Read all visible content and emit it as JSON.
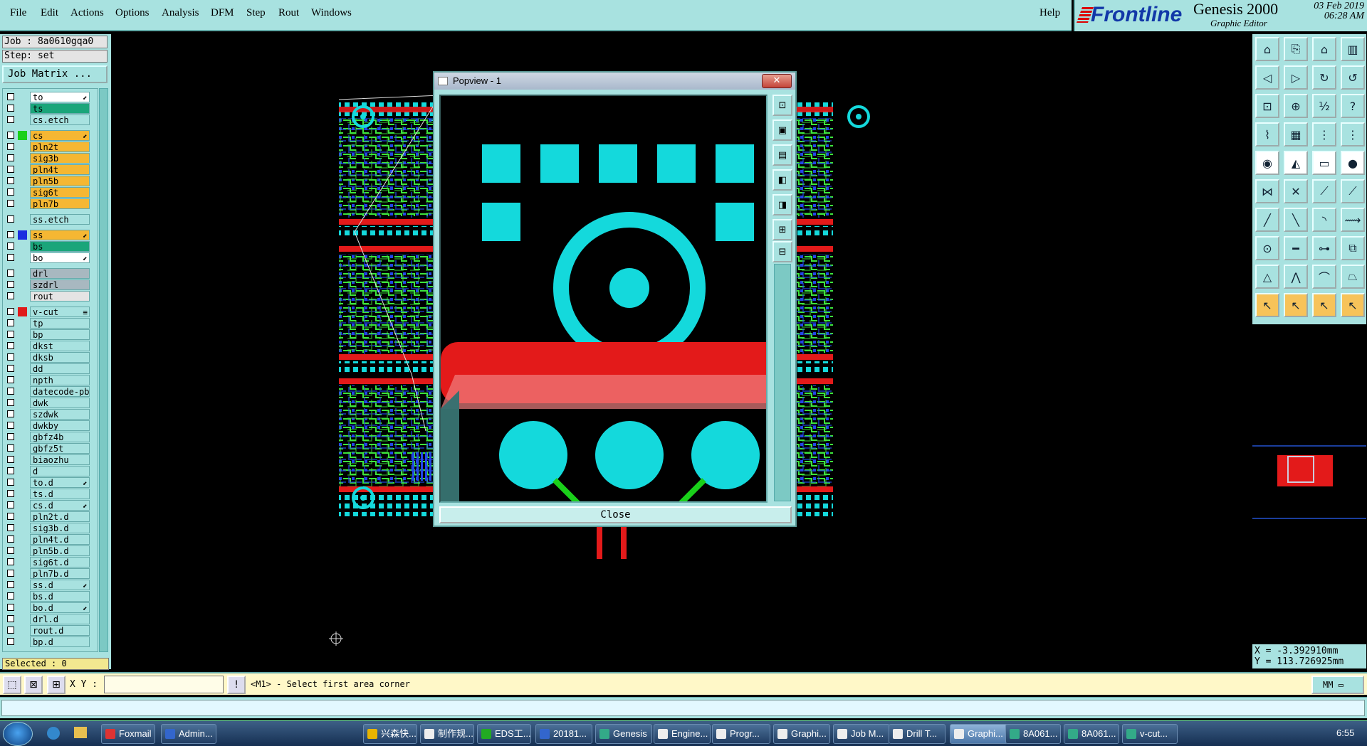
{
  "menubar": {
    "items": [
      "File",
      "Edit",
      "Actions",
      "Options",
      "Analysis",
      "DFM",
      "Step",
      "Rout",
      "Windows"
    ],
    "help": "Help"
  },
  "brand": {
    "logo": "Frontline",
    "title": "Genesis 2000",
    "subtitle": "Graphic Editor",
    "date": "03 Feb 2019",
    "time": "06:28 AM"
  },
  "job": {
    "job_label": "Job : 8a0610gqa0",
    "step_label": "Step: set",
    "matrix_button": "Job Matrix ..."
  },
  "layers": [
    {
      "name": "to",
      "bg": "#ffffff",
      "swatch": "",
      "mark": "⬋"
    },
    {
      "name": "ts",
      "bg": "#1aa57a",
      "swatch": "",
      "mark": ""
    },
    {
      "name": "cs.etch",
      "bg": "#a8e2e0",
      "swatch": "",
      "mark": ""
    },
    {
      "name": "cs",
      "bg": "#f5b733",
      "swatch": "#1ad01a",
      "mark": "⬋"
    },
    {
      "name": "pln2t",
      "bg": "#f5b733",
      "swatch": "",
      "mark": ""
    },
    {
      "name": "sig3b",
      "bg": "#f5b733",
      "swatch": "",
      "mark": ""
    },
    {
      "name": "pln4t",
      "bg": "#f5b733",
      "swatch": "",
      "mark": ""
    },
    {
      "name": "pln5b",
      "bg": "#f5b733",
      "swatch": "",
      "mark": ""
    },
    {
      "name": "sig6t",
      "bg": "#f5b733",
      "swatch": "",
      "mark": ""
    },
    {
      "name": "pln7b",
      "bg": "#f5b733",
      "swatch": "",
      "mark": ""
    },
    {
      "name": "ss.etch",
      "bg": "#a8e2e0",
      "swatch": "",
      "mark": ""
    },
    {
      "name": "ss",
      "bg": "#f5b733",
      "swatch": "#1a2ee0",
      "mark": "⬋"
    },
    {
      "name": "bs",
      "bg": "#1aa57a",
      "swatch": "",
      "mark": ""
    },
    {
      "name": "bo",
      "bg": "#ffffff",
      "swatch": "",
      "mark": "⬋"
    },
    {
      "name": "drl",
      "bg": "#a8b8c0",
      "swatch": "",
      "mark": ""
    },
    {
      "name": "szdrl",
      "bg": "#a8b8c0",
      "swatch": "",
      "mark": ""
    },
    {
      "name": "rout",
      "bg": "#e4e4e4",
      "swatch": "",
      "mark": ""
    },
    {
      "name": "v-cut",
      "bg": "#a8e2e0",
      "swatch": "#e01a1a",
      "mark": "≡"
    },
    {
      "name": "tp",
      "bg": "#a8e2e0",
      "swatch": "",
      "mark": ""
    },
    {
      "name": "bp",
      "bg": "#a8e2e0",
      "swatch": "",
      "mark": ""
    },
    {
      "name": "dkst",
      "bg": "#a8e2e0",
      "swatch": "",
      "mark": ""
    },
    {
      "name": "dksb",
      "bg": "#a8e2e0",
      "swatch": "",
      "mark": ""
    },
    {
      "name": "dd",
      "bg": "#a8e2e0",
      "swatch": "",
      "mark": ""
    },
    {
      "name": "npth",
      "bg": "#a8e2e0",
      "swatch": "",
      "mark": ""
    },
    {
      "name": "datecode-pb",
      "bg": "#a8e2e0",
      "swatch": "",
      "mark": ""
    },
    {
      "name": "dwk",
      "bg": "#a8e2e0",
      "swatch": "",
      "mark": ""
    },
    {
      "name": "szdwk",
      "bg": "#a8e2e0",
      "swatch": "",
      "mark": ""
    },
    {
      "name": "dwkby",
      "bg": "#a8e2e0",
      "swatch": "",
      "mark": ""
    },
    {
      "name": "gbfz4b",
      "bg": "#a8e2e0",
      "swatch": "",
      "mark": ""
    },
    {
      "name": "gbfz5t",
      "bg": "#a8e2e0",
      "swatch": "",
      "mark": ""
    },
    {
      "name": "biaozhu",
      "bg": "#a8e2e0",
      "swatch": "",
      "mark": ""
    },
    {
      "name": "d",
      "bg": "#a8e2e0",
      "swatch": "",
      "mark": ""
    },
    {
      "name": "to.d",
      "bg": "#a8e2e0",
      "swatch": "",
      "mark": "⬋"
    },
    {
      "name": "ts.d",
      "bg": "#a8e2e0",
      "swatch": "",
      "mark": ""
    },
    {
      "name": "cs.d",
      "bg": "#a8e2e0",
      "swatch": "",
      "mark": "⬋"
    },
    {
      "name": "pln2t.d",
      "bg": "#a8e2e0",
      "swatch": "",
      "mark": ""
    },
    {
      "name": "sig3b.d",
      "bg": "#a8e2e0",
      "swatch": "",
      "mark": ""
    },
    {
      "name": "pln4t.d",
      "bg": "#a8e2e0",
      "swatch": "",
      "mark": ""
    },
    {
      "name": "pln5b.d",
      "bg": "#a8e2e0",
      "swatch": "",
      "mark": ""
    },
    {
      "name": "sig6t.d",
      "bg": "#a8e2e0",
      "swatch": "",
      "mark": ""
    },
    {
      "name": "pln7b.d",
      "bg": "#a8e2e0",
      "swatch": "",
      "mark": ""
    },
    {
      "name": "ss.d",
      "bg": "#a8e2e0",
      "swatch": "",
      "mark": "⬋"
    },
    {
      "name": "bs.d",
      "bg": "#a8e2e0",
      "swatch": "",
      "mark": ""
    },
    {
      "name": "bo.d",
      "bg": "#a8e2e0",
      "swatch": "",
      "mark": "⬋"
    },
    {
      "name": "drl.d",
      "bg": "#a8e2e0",
      "swatch": "",
      "mark": ""
    },
    {
      "name": "rout.d",
      "bg": "#a8e2e0",
      "swatch": "",
      "mark": ""
    },
    {
      "name": "bp.d",
      "bg": "#a8e2e0",
      "swatch": "",
      "mark": ""
    }
  ],
  "selected": "Selected : 0",
  "cmd": {
    "xy_label": "X Y :",
    "xy_value": "",
    "prompt": "<M1> - Select first area corner",
    "units": "MM"
  },
  "coords": {
    "x": "X = -3.392910mm",
    "y": "Y = 113.726925mm"
  },
  "popup": {
    "title": "Popview - 1",
    "close_label": "Close"
  },
  "taskbar": {
    "items": [
      {
        "label": "Foxmail",
        "color": "#d33"
      },
      {
        "label": "Admin...",
        "color": "#36c"
      },
      {
        "label": "兴森快...",
        "color": "#e8b400"
      },
      {
        "label": "制作规...",
        "color": "#eee"
      },
      {
        "label": "EDS工...",
        "color": "#2a2"
      },
      {
        "label": "20181...",
        "color": "#36c"
      },
      {
        "label": "Genesis",
        "color": "#3a8"
      },
      {
        "label": "Engine...",
        "color": "#eee"
      },
      {
        "label": "Progr...",
        "color": "#eee"
      },
      {
        "label": "Graphi...",
        "color": "#eee"
      },
      {
        "label": "Job M...",
        "color": "#eee"
      },
      {
        "label": "Drill T...",
        "color": "#eee"
      },
      {
        "label": "Graphi...",
        "color": "#eee"
      },
      {
        "label": "8A061...",
        "color": "#3a8"
      },
      {
        "label": "8A061...",
        "color": "#3a8"
      },
      {
        "label": "v-cut...",
        "color": "#3a8"
      }
    ],
    "clock": "6:55"
  }
}
